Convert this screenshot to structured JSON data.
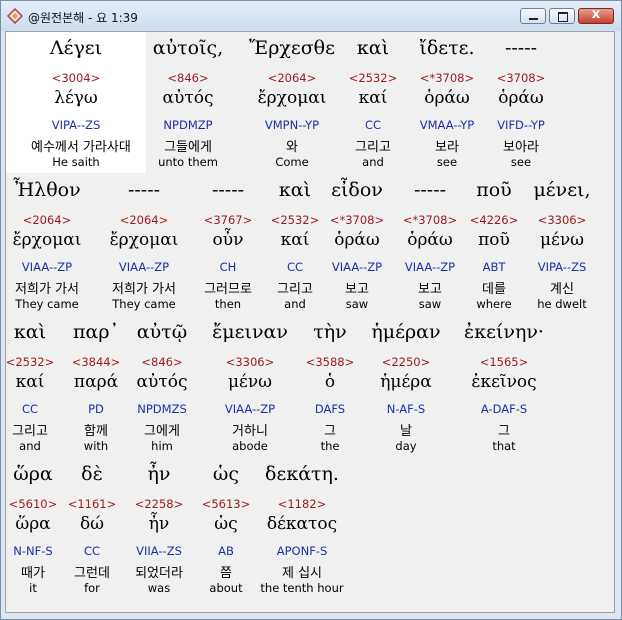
{
  "window": {
    "title": "@원전본해 - 요 1:39",
    "close_label": "x"
  },
  "words": [
    {
      "greek": "Λέγει",
      "strong": "<3004>",
      "lemma": "λέγω",
      "morph": "VIPA--ZS",
      "korean": "예수께서 가라사대",
      "english": "He saith"
    },
    {
      "greek": "αὐτοῖς,",
      "strong": "<846>",
      "lemma": "αὐτός",
      "morph": "NPDMZP",
      "korean": "그들에게",
      "english": "unto them"
    },
    {
      "greek": "Ἔρχεσθε",
      "strong": "<2064>",
      "lemma": "ἔρχομαι",
      "morph": "VMPN--YP",
      "korean": "와",
      "english": "Come"
    },
    {
      "greek": "καὶ",
      "strong": "<2532>",
      "lemma": "καί",
      "morph": "CC",
      "korean": "그리고",
      "english": "and"
    },
    {
      "greek": "ἴδετε.",
      "strong": "<*3708>",
      "lemma": "ὁράω",
      "morph": "VMAA--YP",
      "korean": "보라",
      "english": "see"
    },
    {
      "greek": "-----",
      "strong": "<3708>",
      "lemma": "ὁράω",
      "morph": "VIFD--YP",
      "korean": "보아라",
      "english": "see"
    },
    {
      "greek": "Ἦλθον",
      "strong": "<2064>",
      "lemma": "ἔρχομαι",
      "morph": "VIAA--ZP",
      "korean": "저희가 가서",
      "english": "They came"
    },
    {
      "greek": "-----",
      "strong": "<2064>",
      "lemma": "ἔρχομαι",
      "morph": "VIAA--ZP",
      "korean": "저희가 가서",
      "english": "They came"
    },
    {
      "greek": "-----",
      "strong": "<3767>",
      "lemma": "οὖν",
      "morph": "CH",
      "korean": "그러므로",
      "english": "then"
    },
    {
      "greek": "καὶ",
      "strong": "<2532>",
      "lemma": "καί",
      "morph": "CC",
      "korean": "그리고",
      "english": "and"
    },
    {
      "greek": "εἶδον",
      "strong": "<*3708>",
      "lemma": "ὁράω",
      "morph": "VIAA--ZP",
      "korean": "보고",
      "english": "saw"
    },
    {
      "greek": "-----",
      "strong": "<*3708>",
      "lemma": "ὁράω",
      "morph": "VIAA--ZP",
      "korean": "보고",
      "english": "saw"
    },
    {
      "greek": "ποῦ",
      "strong": "<4226>",
      "lemma": "ποῦ",
      "morph": "ABT",
      "korean": "데를",
      "english": "where"
    },
    {
      "greek": "μένει,",
      "strong": "<3306>",
      "lemma": "μένω",
      "morph": "VIPA--ZS",
      "korean": "계신",
      "english": "he dwelt"
    },
    {
      "greek": "καὶ",
      "strong": "<2532>",
      "lemma": "καί",
      "morph": "CC",
      "korean": "그리고",
      "english": "and"
    },
    {
      "greek": "παρ᾽",
      "strong": "<3844>",
      "lemma": "παρά",
      "morph": "PD",
      "korean": "함께",
      "english": "with"
    },
    {
      "greek": "αὐτῷ",
      "strong": "<846>",
      "lemma": "αὐτός",
      "morph": "NPDMZS",
      "korean": "그에게",
      "english": "him"
    },
    {
      "greek": "ἔμειναν",
      "strong": "<3306>",
      "lemma": "μένω",
      "morph": "VIAA--ZP",
      "korean": "거하니",
      "english": "abode"
    },
    {
      "greek": "τὴν",
      "strong": "<3588>",
      "lemma": "ὁ",
      "morph": "DAFS",
      "korean": "그",
      "english": "the"
    },
    {
      "greek": "ἡμέραν",
      "strong": "<2250>",
      "lemma": "ἡμέρα",
      "morph": "N-AF-S",
      "korean": "날",
      "english": "day"
    },
    {
      "greek": "ἐκείνην·",
      "strong": "<1565>",
      "lemma": "ἐκεῖνος",
      "morph": "A-DAF-S",
      "korean": "그",
      "english": "that"
    },
    {
      "greek": "ὥρα",
      "strong": "<5610>",
      "lemma": "ὥρα",
      "morph": "N-NF-S",
      "korean": "때가",
      "english": "it"
    },
    {
      "greek": "δὲ",
      "strong": "<1161>",
      "lemma": "δώ",
      "morph": "CC",
      "korean": "그런데",
      "english": "for"
    },
    {
      "greek": "ἦν",
      "strong": "<2258>",
      "lemma": "ἦν",
      "morph": "VIIA--ZS",
      "korean": "되었더라",
      "english": "was"
    },
    {
      "greek": "ὡς",
      "strong": "<5613>",
      "lemma": "ὡς",
      "morph": "AB",
      "korean": "쯤",
      "english": "about"
    },
    {
      "greek": "δεκάτη.",
      "strong": "<1182>",
      "lemma": "δέκατος",
      "morph": "APONF-S",
      "korean": "제 십시",
      "english": "the tenth hour"
    }
  ]
}
